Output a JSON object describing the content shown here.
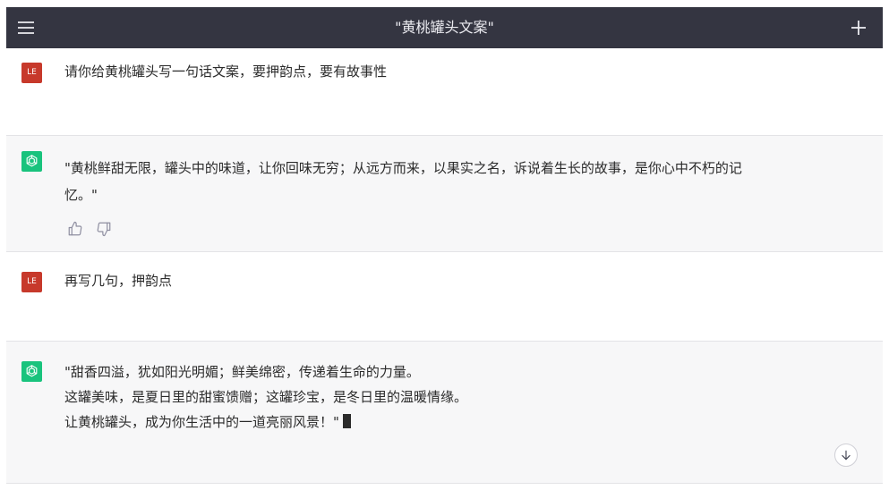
{
  "header": {
    "title": "\"黄桃罐头文案\"",
    "menu_icon": "hamburger-menu-icon",
    "new_chat_icon": "plus-icon"
  },
  "messages": [
    {
      "role": "user",
      "avatar_label": "LE",
      "lines": [
        "请你给黄桃罐头写一句话文案，要押韵点，要有故事性"
      ]
    },
    {
      "role": "assistant",
      "avatar_icon": "openai-logo-icon",
      "lines": [
        "\"黄桃鲜甜无限，罐头中的味道，让你回味无穷；从远方而来，以果实之名，诉说着生长的故事，是你心中不朽的记",
        "忆。\""
      ],
      "feedback_icons": [
        "thumbs-up-icon",
        "thumbs-down-icon"
      ]
    },
    {
      "role": "user",
      "avatar_label": "LE",
      "lines": [
        "再写几句，押韵点"
      ]
    },
    {
      "role": "assistant",
      "avatar_icon": "openai-logo-icon",
      "lines": [
        "\"甜香四溢，犹如阳光明媚；鲜美绵密，传递着生命的力量。",
        "这罐美味，是夏日里的甜蜜馈赠；这罐珍宝，是冬日里的温暖情缘。",
        "让黄桃罐头，成为你生活中的一道亮丽风景！\""
      ],
      "streaming": true
    }
  ],
  "scroll_button_icon": "arrow-down-icon",
  "colors": {
    "topbar": "#343541",
    "user_avatar": "#c7392b",
    "assistant_avatar": "#19c37d",
    "assistant_bg": "#f7f7f8"
  }
}
